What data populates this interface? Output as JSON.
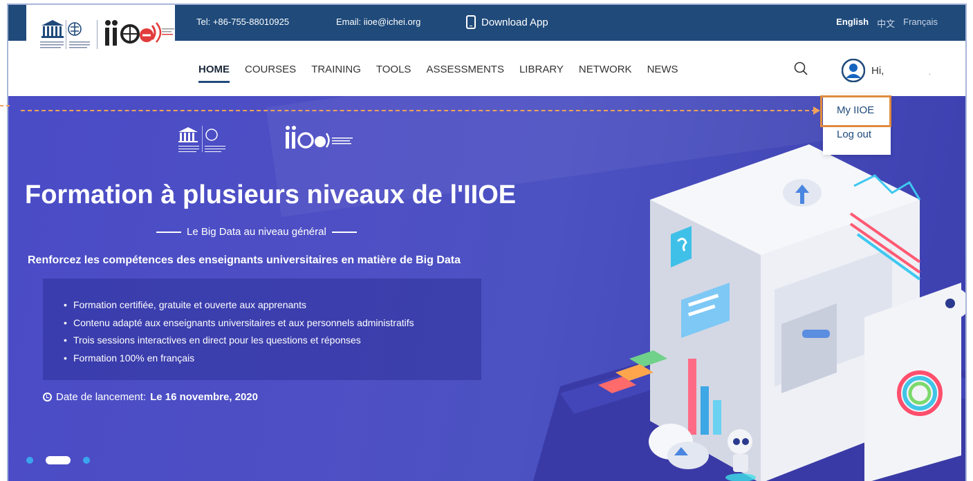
{
  "topbar": {
    "tel": "Tel: +86-755-88010925",
    "email": "Email: iioe@ichei.org",
    "download": "Download App",
    "languages": [
      "English",
      "中文",
      "Français"
    ]
  },
  "nav": {
    "items": [
      "HOME",
      "COURSES",
      "TRAINING",
      "TOOLS",
      "ASSESSMENTS",
      "LIBRARY",
      "NETWORK",
      "NEWS"
    ],
    "active": "HOME",
    "greeting": "Hi,",
    "greeting_suffix": "."
  },
  "dropdown": {
    "items": [
      "My IIOE",
      "Log out"
    ],
    "highlighted": "My IIOE"
  },
  "hero": {
    "title": "Formation à plusieurs niveaux de l'IIOE",
    "subtitle": "Le Big Data au niveau général",
    "lead": "Renforcez les compétences des enseignants universitaires en matière de Big Data",
    "bullets": [
      "Formation certifiée, gratuite et ouverte aux apprenants",
      "Contenu adapté aux enseignants universitaires et aux personnels administratifs",
      "Trois sessions interactives en direct pour les questions et réponses",
      "Formation 100% en français"
    ],
    "launch_label": "Date de lancement:",
    "launch_date": "Le 16 novembre, 2020",
    "carousel": {
      "count": 3,
      "active": 2
    }
  },
  "colors": {
    "topbar": "#1f4a7a",
    "hero": "#4a4cc6",
    "highlight": "#e08b3e",
    "arrow": "#f1a25c",
    "dot": "#3aa5ee"
  }
}
